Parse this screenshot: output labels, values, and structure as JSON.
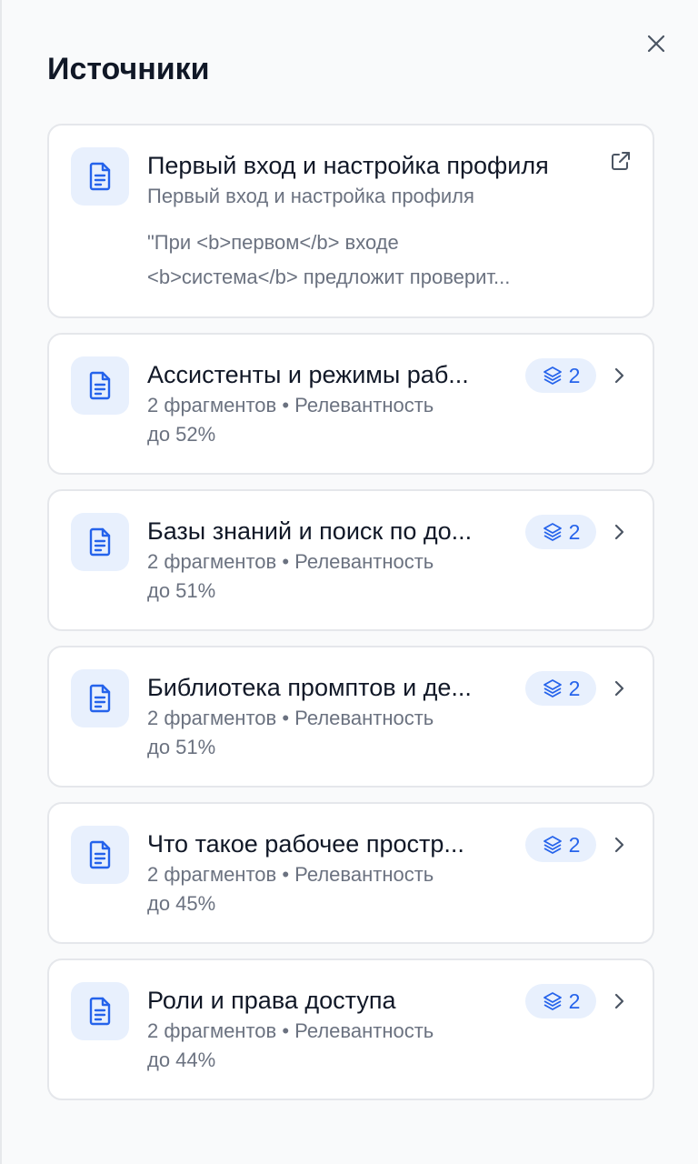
{
  "header": {
    "title": "Источники",
    "close_icon": "close-icon"
  },
  "featured": {
    "title": "Первый вход и настройка профиля",
    "subtitle": "Первый вход и настройка профиля",
    "snippet_line1": "\"При <b>первом</b> входе",
    "snippet_line2": "<b>система</b> предложит проверит..."
  },
  "sources": [
    {
      "title": "Ассистенты и режимы раб...",
      "count": "2",
      "meta_line1": "2 фрагментов • Релевантность",
      "meta_line2": "до 52%"
    },
    {
      "title": "Базы знаний и поиск по до...",
      "count": "2",
      "meta_line1": "2 фрагментов • Релевантность",
      "meta_line2": "до 51%"
    },
    {
      "title": "Библиотека промптов и де...",
      "count": "2",
      "meta_line1": "2 фрагментов • Релевантность",
      "meta_line2": "до 51%"
    },
    {
      "title": "Что такое рабочее простр...",
      "count": "2",
      "meta_line1": "2 фрагментов • Релевантность",
      "meta_line2": "до 45%"
    },
    {
      "title": "Роли и права доступа",
      "count": "2",
      "meta_line1": "2 фрагментов • Релевантность",
      "meta_line2": "до 44%"
    }
  ],
  "colors": {
    "accent": "#2563eb",
    "icon_bg": "#e8f0fd",
    "muted_text": "#6b7280",
    "border": "#e5e7eb"
  }
}
